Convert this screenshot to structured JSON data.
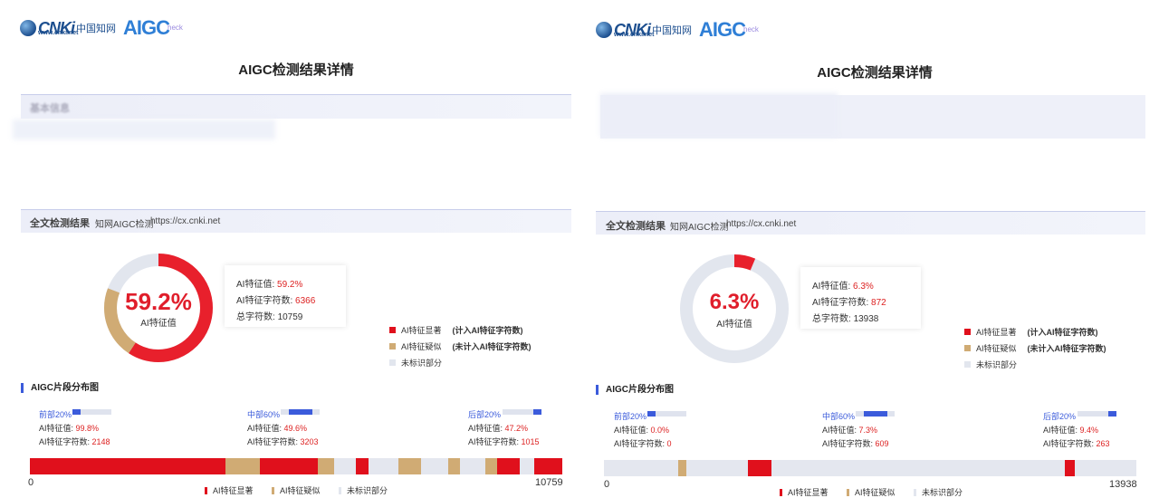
{
  "colors": {
    "red": "#e0101c",
    "tan": "#d0ab74",
    "grey": "#e2e6ee",
    "blue": "#3b5bdb"
  },
  "brand": {
    "logo_main": "CNKi",
    "logo_cn": "中国知网",
    "logo_url": "www.cnki.net",
    "logo_aigc": "AIGC",
    "logo_check": "heck"
  },
  "panels": [
    {
      "title": "AIGC检测结果详情",
      "basic_info_label": "基本信息",
      "full_label": "全文检测结果",
      "full_sub": "知网AIGC检测",
      "full_url": "https://cx.cnki.net",
      "donut": {
        "percent_text": "59.2%",
        "caption": "AI特征值",
        "red_fraction": 0.592,
        "tan_fraction": 0.216
      },
      "stats": {
        "ai_value_label": "AI特征值:",
        "ai_value": "59.2%",
        "ai_chars_label": "AI特征字符数:",
        "ai_chars": "6366",
        "total_label": "总字符数:",
        "total": "10759"
      },
      "legend": [
        {
          "color": "red",
          "label": "AI特征显著",
          "note": "(计入AI特征字符数)"
        },
        {
          "color": "tan",
          "label": "AI特征疑似",
          "note": "(未计入AI特征字符数)"
        },
        {
          "color": "grey",
          "label": "未标识部分",
          "note": ""
        }
      ],
      "dist_title": "AIGC片段分布图",
      "segments": [
        {
          "head": "前部20%",
          "bar_fill": 0.998,
          "ai_value_label": "AI特征值:",
          "ai_value": "99.8%",
          "ai_chars_label": "AI特征字符数:",
          "ai_chars": "2148"
        },
        {
          "head": "中部60%",
          "bar_fill": 0.496,
          "ai_value_label": "AI特征值:",
          "ai_value": "49.6%",
          "ai_chars_label": "AI特征字符数:",
          "ai_chars": "3203"
        },
        {
          "head": "后部20%",
          "bar_fill": 0.472,
          "ai_value_label": "AI特征值:",
          "ai_value": "47.2%",
          "ai_chars_label": "AI特征字符数:",
          "ai_chars": "1015"
        }
      ],
      "track_blocks": [
        {
          "type": "red",
          "start": 0.0,
          "end": 0.367
        },
        {
          "type": "tan",
          "start": 0.367,
          "end": 0.432
        },
        {
          "type": "red",
          "start": 0.432,
          "end": 0.541
        },
        {
          "type": "tan",
          "start": 0.541,
          "end": 0.572
        },
        {
          "type": "red",
          "start": 0.612,
          "end": 0.636
        },
        {
          "type": "tan",
          "start": 0.693,
          "end": 0.735
        },
        {
          "type": "tan",
          "start": 0.785,
          "end": 0.808
        },
        {
          "type": "tan",
          "start": 0.856,
          "end": 0.878
        },
        {
          "type": "red",
          "start": 0.878,
          "end": 0.92
        },
        {
          "type": "red",
          "start": 0.947,
          "end": 1.0
        }
      ],
      "axis_start": "0",
      "axis_end": "10759",
      "bottom_legend": [
        "AI特征显著",
        "AI特征疑似",
        "未标识部分"
      ]
    },
    {
      "title": "AIGC检测结果详情",
      "basic_info_label": "",
      "full_label": "全文检测结果",
      "full_sub": "知网AIGC检测",
      "full_url": "https://cx.cnki.net",
      "donut": {
        "percent_text": "6.3%",
        "caption": "AI特征值",
        "red_fraction": 0.063,
        "tan_fraction": 0.0
      },
      "stats": {
        "ai_value_label": "AI特征值:",
        "ai_value": "6.3%",
        "ai_chars_label": "AI特征字符数:",
        "ai_chars": "872",
        "total_label": "总字符数:",
        "total": "13938"
      },
      "legend": [
        {
          "color": "red",
          "label": "AI特征显著",
          "note": "(计入AI特征字符数)"
        },
        {
          "color": "tan",
          "label": "AI特征疑似",
          "note": "(未计入AI特征字符数)"
        },
        {
          "color": "grey",
          "label": "未标识部分",
          "note": ""
        }
      ],
      "dist_title": "AIGC片段分布图",
      "segments": [
        {
          "head": "前部20%",
          "bar_fill": 0.0,
          "ai_value_label": "AI特征值:",
          "ai_value": "0.0%",
          "ai_chars_label": "AI特征字符数:",
          "ai_chars": "0"
        },
        {
          "head": "中部60%",
          "bar_fill": 0.073,
          "ai_value_label": "AI特征值:",
          "ai_value": "7.3%",
          "ai_chars_label": "AI特征字符数:",
          "ai_chars": "609"
        },
        {
          "head": "后部20%",
          "bar_fill": 0.094,
          "ai_value_label": "AI特征值:",
          "ai_value": "9.4%",
          "ai_chars_label": "AI特征字符数:",
          "ai_chars": "263"
        }
      ],
      "track_blocks": [
        {
          "type": "tan",
          "start": 0.139,
          "end": 0.155
        },
        {
          "type": "red",
          "start": 0.27,
          "end": 0.314
        },
        {
          "type": "red",
          "start": 0.865,
          "end": 0.884
        }
      ],
      "axis_start": "0",
      "axis_end": "13938",
      "bottom_legend": [
        "AI特征显著",
        "AI特征疑似",
        "未标识部分"
      ]
    }
  ]
}
